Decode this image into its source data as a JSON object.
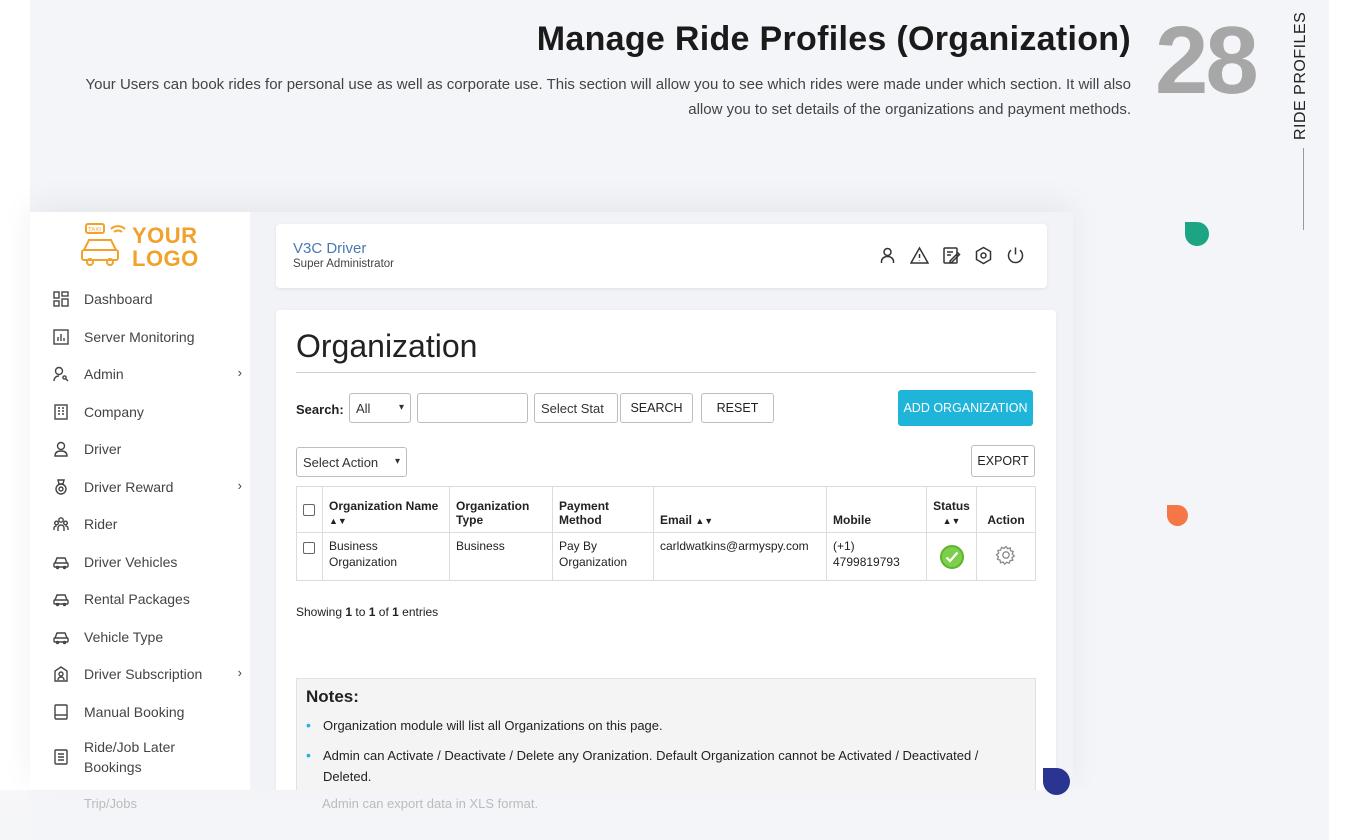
{
  "header": {
    "title": "Manage Ride Profiles (Organization)",
    "description": "Your Users can book rides for personal use as well as corporate use. This section will allow you to see which rides were made under which section. It will also allow you to set details of the organizations and payment methods.",
    "page_number": "28",
    "side_label": "RIDE PROFILES"
  },
  "logo": {
    "line1": "YOUR",
    "line2": "LOGO",
    "badge": "TAXI"
  },
  "sidebar": {
    "items": [
      {
        "label": "Dashboard",
        "icon": "dashboard-icon",
        "submenu": false
      },
      {
        "label": "Server Monitoring",
        "icon": "chart-icon",
        "submenu": false
      },
      {
        "label": "Admin",
        "icon": "user-key-icon",
        "submenu": true
      },
      {
        "label": "Company",
        "icon": "building-icon",
        "submenu": false
      },
      {
        "label": "Driver",
        "icon": "user-icon",
        "submenu": false
      },
      {
        "label": "Driver Reward",
        "icon": "medal-icon",
        "submenu": true
      },
      {
        "label": "Rider",
        "icon": "group-icon",
        "submenu": false
      },
      {
        "label": "Driver Vehicles",
        "icon": "car-icon",
        "submenu": false
      },
      {
        "label": "Rental Packages",
        "icon": "car-icon",
        "submenu": false
      },
      {
        "label": "Vehicle Type",
        "icon": "car-icon",
        "submenu": false
      },
      {
        "label": "Driver Subscription",
        "icon": "subscription-icon",
        "submenu": true
      },
      {
        "label": "Manual Booking",
        "icon": "book-icon",
        "submenu": false
      },
      {
        "label": "Ride/Job Later\nBookings",
        "icon": "list-icon",
        "submenu": false
      }
    ],
    "faded_item": "Trip/Jobs"
  },
  "topbar": {
    "app_name": "V3C Driver",
    "role": "Super Administrator"
  },
  "main": {
    "title": "Organization",
    "search_label": "Search:",
    "filter_select": "All",
    "search_value": "",
    "status_select": "Select Stat",
    "search_button": "SEARCH",
    "reset_button": "RESET",
    "add_button": "ADD ORGANIZATION",
    "action_select": "Select Action",
    "export_button": "EXPORT",
    "table": {
      "headers": [
        "Organization Name",
        "Organization Type",
        "Payment Method",
        "Email",
        "Mobile",
        "Status",
        "Action"
      ],
      "rows": [
        {
          "name": "Business Organization",
          "type": "Business",
          "payment": "Pay By Organization",
          "email": "carldwatkins@armyspy.com",
          "mobile": "(+1) 4799819793",
          "status": "active"
        }
      ]
    },
    "showing": {
      "prefix": "Showing ",
      "from": "1",
      "to_word": " to ",
      "to": "1",
      "of_word": " of ",
      "total": "1",
      "suffix": " entries"
    }
  },
  "notes": {
    "title": "Notes:",
    "items": [
      "Organization module will list all Organizations on this page.",
      "Admin can Activate / Deactivate / Delete any Oranization. Default Organization cannot be Activated / Deactivated / Deleted.",
      "Admin can export data in XLS format."
    ]
  },
  "colors": {
    "accent": "#1fb4d9",
    "logo": "#f1a22b",
    "status_active": "#7ccf4b",
    "big_number": "#a7a7a7"
  }
}
